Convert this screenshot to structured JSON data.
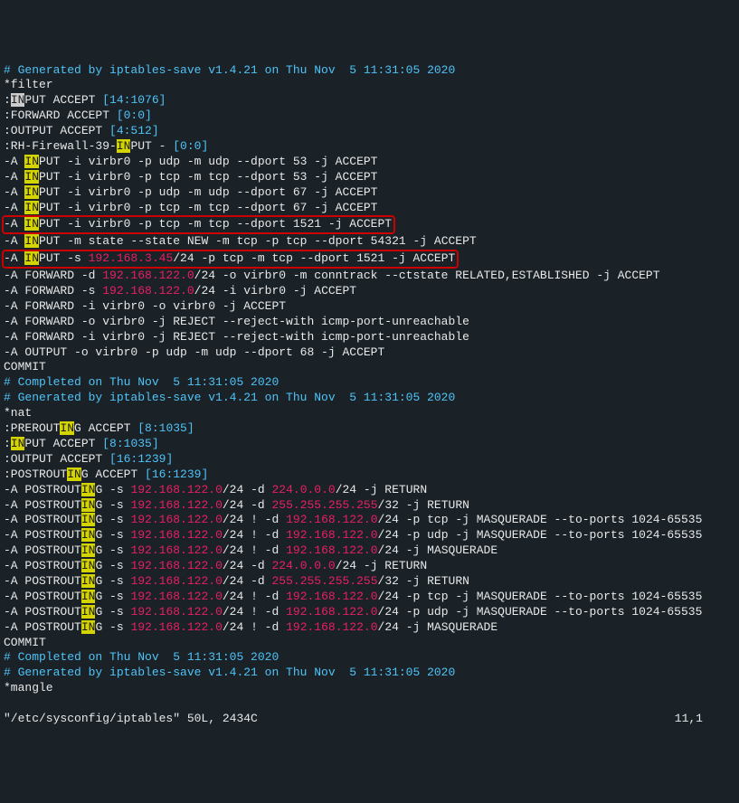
{
  "lines": [
    {
      "type": "comment",
      "text": "# Generated by iptables-save v1.4.21 on Thu Nov  5 11:31:05 2020"
    },
    {
      "type": "white",
      "text": "*filter"
    },
    {
      "type": "policy",
      "prefix": ":",
      "hl": "IN",
      "rest": "PUT ACCEPT ",
      "counter": "[14:1076]",
      "cursor": true
    },
    {
      "type": "plain",
      "text": ":FORWARD ACCEPT ",
      "counter": "[0:0]"
    },
    {
      "type": "plain",
      "text": ":OUTPUT ACCEPT ",
      "counter": "[4:512]"
    },
    {
      "type": "chain",
      "pre": ":RH-Firewall-39-",
      "hl": "IN",
      "post": "PUT - ",
      "counter": "[0:0]"
    },
    {
      "type": "rule",
      "pre": "-A ",
      "hl": "IN",
      "post": "PUT -i virbr0 -p udp -m udp --dport 53 -j ACCEPT"
    },
    {
      "type": "rule",
      "pre": "-A ",
      "hl": "IN",
      "post": "PUT -i virbr0 -p tcp -m tcp --dport 53 -j ACCEPT"
    },
    {
      "type": "rule",
      "pre": "-A ",
      "hl": "IN",
      "post": "PUT -i virbr0 -p udp -m udp --dport 67 -j ACCEPT"
    },
    {
      "type": "rule",
      "pre": "-A ",
      "hl": "IN",
      "post": "PUT -i virbr0 -p tcp -m tcp --dport 67 -j ACCEPT"
    },
    {
      "type": "rule-red",
      "pre": "-A ",
      "hl": "IN",
      "post": "PUT -i virbr0 -p tcp -m tcp --dport 1521 -j ACCEPT"
    },
    {
      "type": "rule",
      "pre": "-A ",
      "hl": "IN",
      "post": "PUT -m state --state NEW -m tcp -p tcp --dport 54321 -j ACCEPT"
    },
    {
      "type": "rule-red-ip",
      "pre": "-A ",
      "hl": "IN",
      "post1": "PUT -s ",
      "ip": "192.168.3.45",
      "post2": "/24 -p tcp -m tcp --dport 1521 -j ACCEPT"
    },
    {
      "type": "rule-ip",
      "pre": "-A FORWARD -d ",
      "ip": "192.168.122.0",
      "post": "/24 -o virbr0 -m conntrack --ctstate RELATED,ESTABLISHED -j ACCEPT"
    },
    {
      "type": "rule-ip",
      "pre": "-A FORWARD -s ",
      "ip": "192.168.122.0",
      "post": "/24 -i virbr0 -j ACCEPT"
    },
    {
      "type": "plain-rule",
      "text": "-A FORWARD -i virbr0 -o virbr0 -j ACCEPT"
    },
    {
      "type": "plain-rule",
      "text": "-A FORWARD -o virbr0 -j REJECT --reject-with icmp-port-unreachable"
    },
    {
      "type": "plain-rule",
      "text": "-A FORWARD -i virbr0 -j REJECT --reject-with icmp-port-unreachable"
    },
    {
      "type": "plain-rule",
      "text": "-A OUTPUT -o virbr0 -p udp -m udp --dport 68 -j ACCEPT"
    },
    {
      "type": "white",
      "text": "COMMIT"
    },
    {
      "type": "comment",
      "text": "# Completed on Thu Nov  5 11:31:05 2020"
    },
    {
      "type": "comment",
      "text": "# Generated by iptables-save v1.4.21 on Thu Nov  5 11:31:05 2020"
    },
    {
      "type": "white",
      "text": "*nat"
    },
    {
      "type": "chain",
      "pre": ":PREROUT",
      "hl": "IN",
      "post": "G ACCEPT ",
      "counter": "[8:1035]"
    },
    {
      "type": "policy",
      "prefix": ":",
      "hl": "IN",
      "rest": "PUT ACCEPT ",
      "counter": "[8:1035]"
    },
    {
      "type": "plain",
      "text": ":OUTPUT ACCEPT ",
      "counter": "[16:1239]"
    },
    {
      "type": "chain",
      "pre": ":POSTROUT",
      "hl": "IN",
      "post": "G ACCEPT ",
      "counter": "[16:1239]"
    },
    {
      "type": "post-rule",
      "pre": "-A POSTROUT",
      "hl": "IN",
      "post1": "G -s ",
      "ip": "192.168.122.0",
      "post2": "/24 -d ",
      "ip2": "224.0.0.0",
      "post3": "/24 -j RETURN"
    },
    {
      "type": "post-rule",
      "pre": "-A POSTROUT",
      "hl": "IN",
      "post1": "G -s ",
      "ip": "192.168.122.0",
      "post2": "/24 -d ",
      "ip2": "255.255.255.255",
      "post3": "/32 -j RETURN"
    },
    {
      "type": "post-rule",
      "pre": "-A POSTROUT",
      "hl": "IN",
      "post1": "G -s ",
      "ip": "192.168.122.0",
      "post2": "/24 ! -d ",
      "ip2": "192.168.122.0",
      "post3": "/24 -p tcp -j MASQUERADE --to-ports 1024-65535"
    },
    {
      "type": "post-rule",
      "pre": "-A POSTROUT",
      "hl": "IN",
      "post1": "G -s ",
      "ip": "192.168.122.0",
      "post2": "/24 ! -d ",
      "ip2": "192.168.122.0",
      "post3": "/24 -p udp -j MASQUERADE --to-ports 1024-65535"
    },
    {
      "type": "post-rule",
      "pre": "-A POSTROUT",
      "hl": "IN",
      "post1": "G -s ",
      "ip": "192.168.122.0",
      "post2": "/24 ! -d ",
      "ip2": "192.168.122.0",
      "post3": "/24 -j MASQUERADE"
    },
    {
      "type": "post-rule",
      "pre": "-A POSTROUT",
      "hl": "IN",
      "post1": "G -s ",
      "ip": "192.168.122.0",
      "post2": "/24 -d ",
      "ip2": "224.0.0.0",
      "post3": "/24 -j RETURN"
    },
    {
      "type": "post-rule",
      "pre": "-A POSTROUT",
      "hl": "IN",
      "post1": "G -s ",
      "ip": "192.168.122.0",
      "post2": "/24 -d ",
      "ip2": "255.255.255.255",
      "post3": "/32 -j RETURN"
    },
    {
      "type": "post-rule",
      "pre": "-A POSTROUT",
      "hl": "IN",
      "post1": "G -s ",
      "ip": "192.168.122.0",
      "post2": "/24 ! -d ",
      "ip2": "192.168.122.0",
      "post3": "/24 -p tcp -j MASQUERADE --to-ports 1024-65535"
    },
    {
      "type": "post-rule",
      "pre": "-A POSTROUT",
      "hl": "IN",
      "post1": "G -s ",
      "ip": "192.168.122.0",
      "post2": "/24 ! -d ",
      "ip2": "192.168.122.0",
      "post3": "/24 -p udp -j MASQUERADE --to-ports 1024-65535"
    },
    {
      "type": "post-rule",
      "pre": "-A POSTROUT",
      "hl": "IN",
      "post1": "G -s ",
      "ip": "192.168.122.0",
      "post2": "/24 ! -d ",
      "ip2": "192.168.122.0",
      "post3": "/24 -j MASQUERADE"
    },
    {
      "type": "white",
      "text": "COMMIT"
    },
    {
      "type": "comment",
      "text": "# Completed on Thu Nov  5 11:31:05 2020"
    },
    {
      "type": "comment",
      "text": "# Generated by iptables-save v1.4.21 on Thu Nov  5 11:31:05 2020"
    },
    {
      "type": "white",
      "text": "*mangle"
    }
  ],
  "status": {
    "file": "\"/etc/sysconfig/iptables\" 50L, 2434C",
    "pos": "11,1"
  }
}
